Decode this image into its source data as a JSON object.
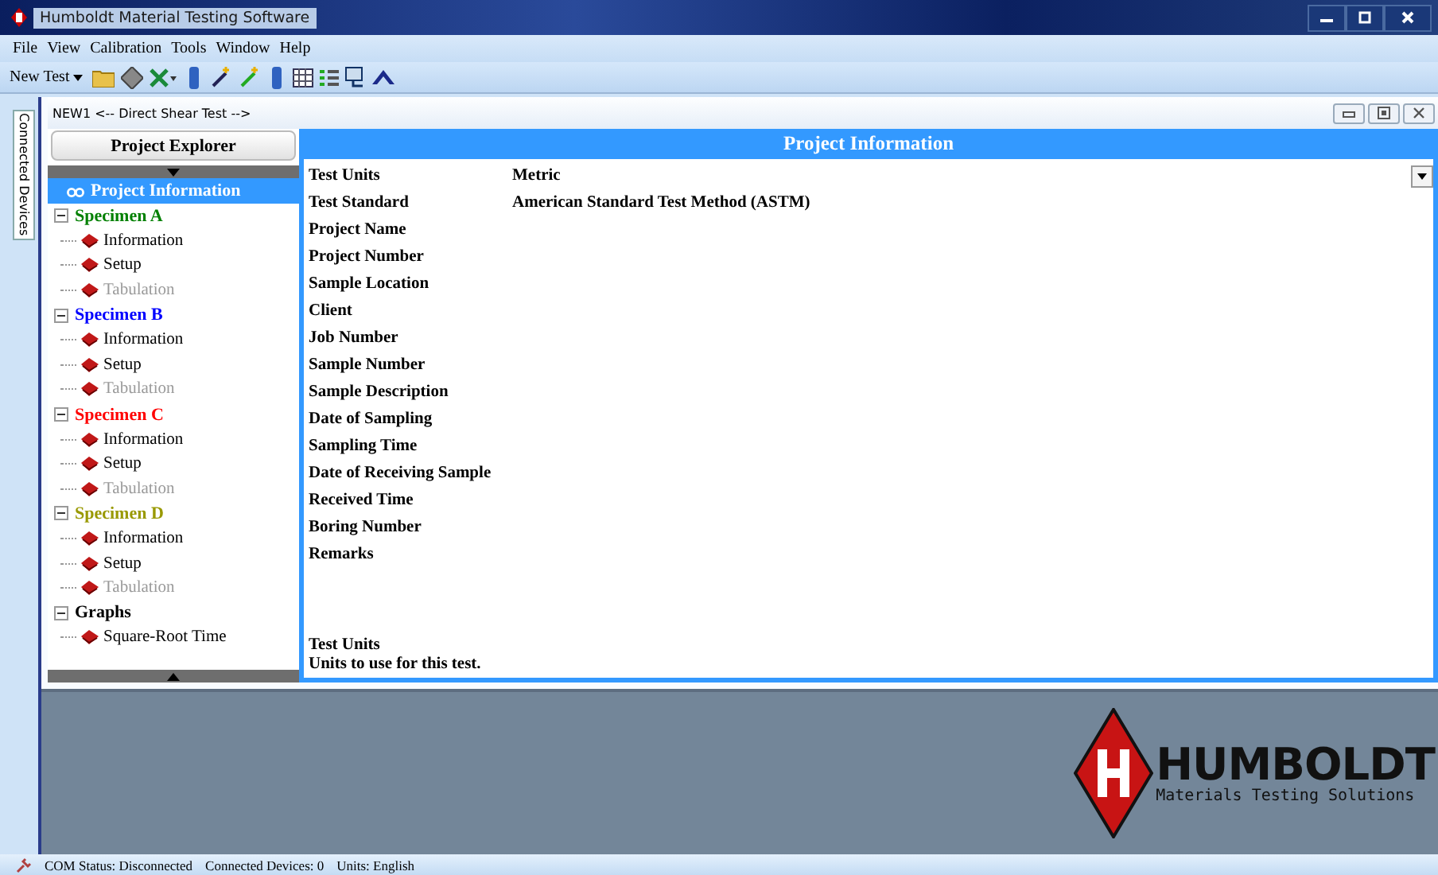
{
  "window": {
    "title": "Humboldt Material Testing Software"
  },
  "menu": [
    "File",
    "View",
    "Calibration",
    "Tools",
    "Window",
    "Help"
  ],
  "toolbar": {
    "new_test": "New Test"
  },
  "side_tab": {
    "label": "Connected Devices"
  },
  "document": {
    "title": "NEW1 <-- Direct Shear Test -->"
  },
  "explorer": {
    "title": "Project Explorer",
    "tree": [
      {
        "label": "Project Information",
        "kind": "root",
        "selected": true
      },
      {
        "label": "Specimen A",
        "kind": "group",
        "color": "#008000",
        "expanded": true,
        "selected": false,
        "children": [
          {
            "label": "Information",
            "disabled": false,
            "selected": false
          },
          {
            "label": "Setup",
            "disabled": false,
            "selected": false
          },
          {
            "label": "Tabulation",
            "disabled": true,
            "selected": false
          }
        ]
      },
      {
        "label": "Specimen B",
        "kind": "group",
        "color": "#0000ff",
        "expanded": true,
        "selected": false,
        "children": [
          {
            "label": "Information",
            "disabled": false,
            "selected": false
          },
          {
            "label": "Setup",
            "disabled": false,
            "selected": false
          },
          {
            "label": "Tabulation",
            "disabled": true,
            "selected": false
          }
        ]
      },
      {
        "label": "Specimen C",
        "kind": "group",
        "color": "#ff0000",
        "expanded": true,
        "selected": false,
        "children": [
          {
            "label": "Information",
            "disabled": false,
            "selected": false
          },
          {
            "label": "Setup",
            "disabled": false,
            "selected": false
          },
          {
            "label": "Tabulation",
            "disabled": true,
            "selected": false
          }
        ]
      },
      {
        "label": "Specimen D",
        "kind": "group",
        "color": "#999900",
        "expanded": true,
        "selected": false,
        "children": [
          {
            "label": "Information",
            "disabled": false,
            "selected": false
          },
          {
            "label": "Setup",
            "disabled": false,
            "selected": false
          },
          {
            "label": "Tabulation",
            "disabled": true,
            "selected": false
          }
        ]
      },
      {
        "label": "Graphs",
        "kind": "group",
        "color": "#000000",
        "expanded": true,
        "selected": false,
        "children": [
          {
            "label": "Square-Root Time",
            "disabled": false,
            "selected": false
          }
        ]
      }
    ]
  },
  "panel": {
    "title": "Project Information",
    "fields": [
      {
        "label": "Test Units",
        "value": "Metric",
        "kind": "dropdown"
      },
      {
        "label": "Test Standard",
        "value": "American Standard Test Method (ASTM)",
        "kind": "text"
      },
      {
        "label": "Project Name",
        "kind": "text"
      },
      {
        "label": "Project Number",
        "kind": "text"
      },
      {
        "label": "Sample Location",
        "kind": "text"
      },
      {
        "label": "Client",
        "kind": "text"
      },
      {
        "label": "Job Number",
        "kind": "text"
      },
      {
        "label": "Sample Number",
        "kind": "text"
      },
      {
        "label": "Sample Description",
        "kind": "text"
      },
      {
        "label": "Date of Sampling",
        "kind": "text"
      },
      {
        "label": "Sampling Time",
        "kind": "text"
      },
      {
        "label": "Date of Receiving Sample",
        "kind": "text"
      },
      {
        "label": "Received Time",
        "kind": "text"
      },
      {
        "label": "Boring Number",
        "kind": "text"
      },
      {
        "label": "Remarks",
        "kind": "text"
      }
    ],
    "help": {
      "title": "Test Units",
      "text": "Units to use for this test."
    }
  },
  "logo": {
    "name": "HUMBOLDT",
    "tagline": "Materials Testing Solutions"
  },
  "status_bar": [
    "COM Status: Disconnected",
    "Connected Devices: 0",
    "Units: English"
  ]
}
